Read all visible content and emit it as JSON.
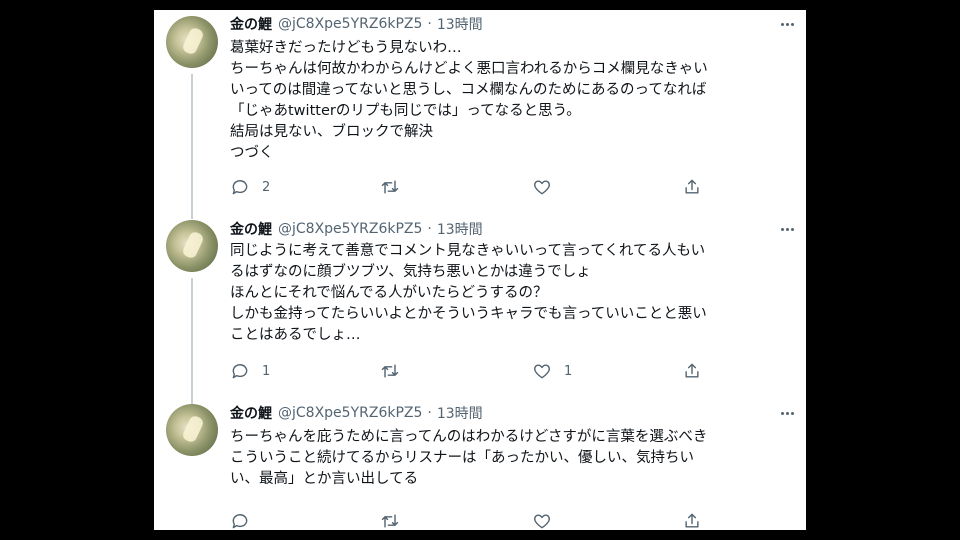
{
  "tweets": [
    {
      "name": "金の鯉",
      "handle": "@jC8Xpe5YRZ6kPZ5",
      "dot": "·",
      "time": "13時間",
      "lines": [
        "葛葉好きだったけどもう見ないわ…",
        "ちーちゃんは何故かわからんけどよく悪口言われるからコメ欄見なきゃい",
        "いってのは間違ってないと思うし、コメ欄なんのためにあるのってなれば",
        "「じゃあtwitterのリプも同じでは」ってなると思う。",
        "結局は見ない、ブロックで解決",
        "つづく"
      ],
      "reply_count": "2",
      "retweet_count": "",
      "like_count": ""
    },
    {
      "name": "金の鯉",
      "handle": "@jC8Xpe5YRZ6kPZ5",
      "dot": "·",
      "time": "13時間",
      "lines": [
        "同じように考えて善意でコメント見なきゃいいって言ってくれてる人もい",
        "るはずなのに顔ブツブツ、気持ち悪いとかは違うでしょ",
        "ほんとにそれで悩んでる人がいたらどうするの？",
        "しかも金持ってたらいいよとかそういうキャラでも言っていいことと悪い",
        "ことはあるでしょ…"
      ],
      "reply_count": "1",
      "retweet_count": "",
      "like_count": "1"
    },
    {
      "name": "金の鯉",
      "handle": "@jC8Xpe5YRZ6kPZ5",
      "dot": "·",
      "time": "13時間",
      "lines": [
        "ちーちゃんを庇うために言ってんのはわかるけどさすがに言葉を選ぶべき",
        "こういうこと続けてるからリスナーは「あったかい、優しい、気持ちい",
        "い、最高」とか言い出してる"
      ],
      "reply_count": "",
      "retweet_count": "",
      "like_count": ""
    }
  ],
  "icons": [
    "reply-icon",
    "retweet-icon",
    "like-icon",
    "share-icon",
    "more-icon"
  ],
  "colors": {
    "background": "#000000",
    "panel": "#ffffff",
    "text": "#0f1419",
    "muted": "#536471",
    "thread_line": "#c4cfd6"
  }
}
